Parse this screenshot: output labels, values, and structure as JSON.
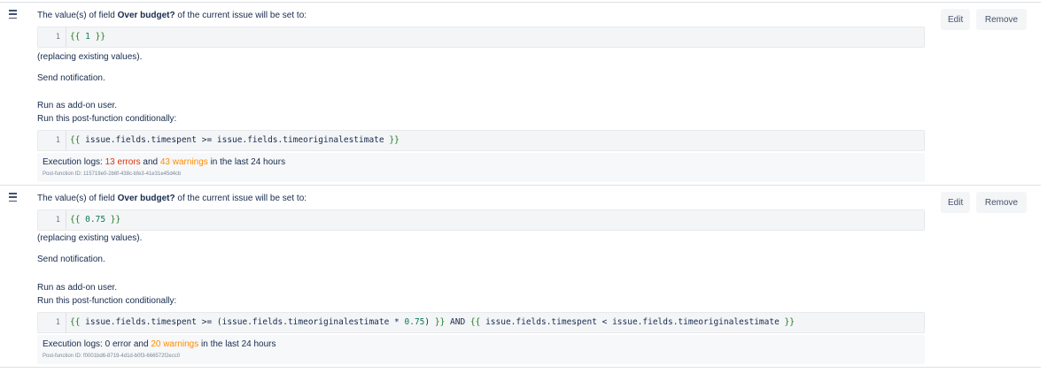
{
  "post_functions": [
    {
      "header_prefix": "The value(s) of field ",
      "field_name": "Over budget?",
      "header_suffix": " of the current issue will be set to:",
      "value_code": {
        "line_number": "1",
        "open": "{{",
        "value": " 1 ",
        "close": "}}"
      },
      "replacing_text": "(replacing existing values).",
      "send_notification": "Send notification.",
      "run_as": "Run as add-on user.",
      "run_conditionally": "Run this post-function conditionally:",
      "condition_code": {
        "line_number": "1",
        "open": "{{",
        "body": " issue.fields.timespent >= issue.fields.timeoriginalestimate ",
        "close": "}}"
      },
      "logs": {
        "prefix": "Execution logs: ",
        "errors": "13 errors",
        "middle": " and ",
        "warnings": "43 warnings",
        "suffix": " in the last 24 hours"
      },
      "post_function_id": "Post-function ID: 115719e0-2b6f-438c-bfe3-41e31e45d4cb",
      "edit_label": "Edit",
      "remove_label": "Remove"
    },
    {
      "header_prefix": "The value(s) of field ",
      "field_name": "Over budget?",
      "header_suffix": " of the current issue will be set to:",
      "value_code": {
        "line_number": "1",
        "open": "{{",
        "value": " 0.75 ",
        "close": "}}"
      },
      "replacing_text": "(replacing existing values).",
      "send_notification": "Send notification.",
      "run_as": "Run as add-on user.",
      "run_conditionally": "Run this post-function conditionally:",
      "condition_code": {
        "line_number": "1",
        "open": "{{",
        "part1": " issue.fields.timespent >= (issue.fields.timeoriginalestimate * ",
        "num": "0.75",
        "part2": ") ",
        "close1": "}}",
        "and": " AND ",
        "open2": "{{",
        "part3": " issue.fields.timespent < issue.fields.timeoriginalestimate ",
        "close": "}}"
      },
      "logs": {
        "prefix": "Execution logs: ",
        "errors": "0 error",
        "middle": " and ",
        "warnings": "20 warnings",
        "suffix": " in the last 24 hours"
      },
      "post_function_id": "Post-function ID: f0001bd6-8719-4d1d-b0f3-666572f2ecc0",
      "edit_label": "Edit",
      "remove_label": "Remove"
    }
  ],
  "colors": {
    "error": "#de350b",
    "warning": "#ff8b00",
    "code_brace": "#1f7a1f"
  },
  "icons": {
    "drag_handle": "drag-handle-icon"
  }
}
